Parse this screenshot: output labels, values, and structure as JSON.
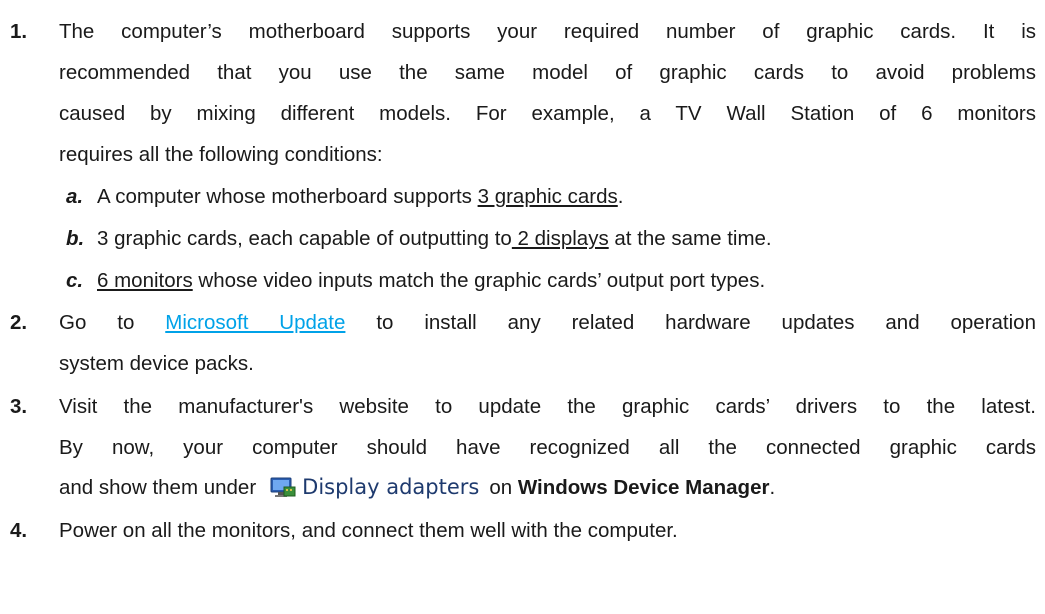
{
  "items": [
    {
      "num": "1.",
      "l1": "The computer’s motherboard supports your required number of graphic cards. It is",
      "l2": "recommended that you use the same model of graphic cards to avoid problems",
      "l3": "caused by mixing different models.   For example, a TV Wall Station of 6 monitors",
      "l4": "requires all the following conditions:",
      "subs": [
        {
          "letter": "a.",
          "pre": "A computer whose motherboard supports ",
          "u": "3 graphic cards",
          "post": "."
        },
        {
          "letter": "b.",
          "pre": "3 graphic cards, each capable of outputting to",
          "u": " 2 displays",
          "post": " at the same time."
        },
        {
          "letter": "c.",
          "pre": "",
          "u": "6 monitors",
          "post": " whose video inputs match the graphic cards’ output port types."
        }
      ]
    },
    {
      "num": "2.",
      "pre": "Go to ",
      "link": "Microsoft Update",
      "post": " to install any related hardware updates and operation",
      "l2": "system device packs."
    },
    {
      "num": "3.",
      "l1": "Visit the manufacturer's website to update the graphic cards’ drivers to the latest.",
      "l2": "By now, your computer should have recognized all the connected graphic cards",
      "l3_pre": "and show them under",
      "icon": "display-adapter-icon",
      "icon_label": "Display adapters",
      "l3_mid": "on ",
      "l3_bold": "Windows Device Manager",
      "l3_post": "."
    },
    {
      "num": "4.",
      "l1": "Power on all the monitors, and connect them well with the computer."
    }
  ],
  "colors": {
    "text": "#1a1a1a",
    "link": "#00a2e8"
  }
}
